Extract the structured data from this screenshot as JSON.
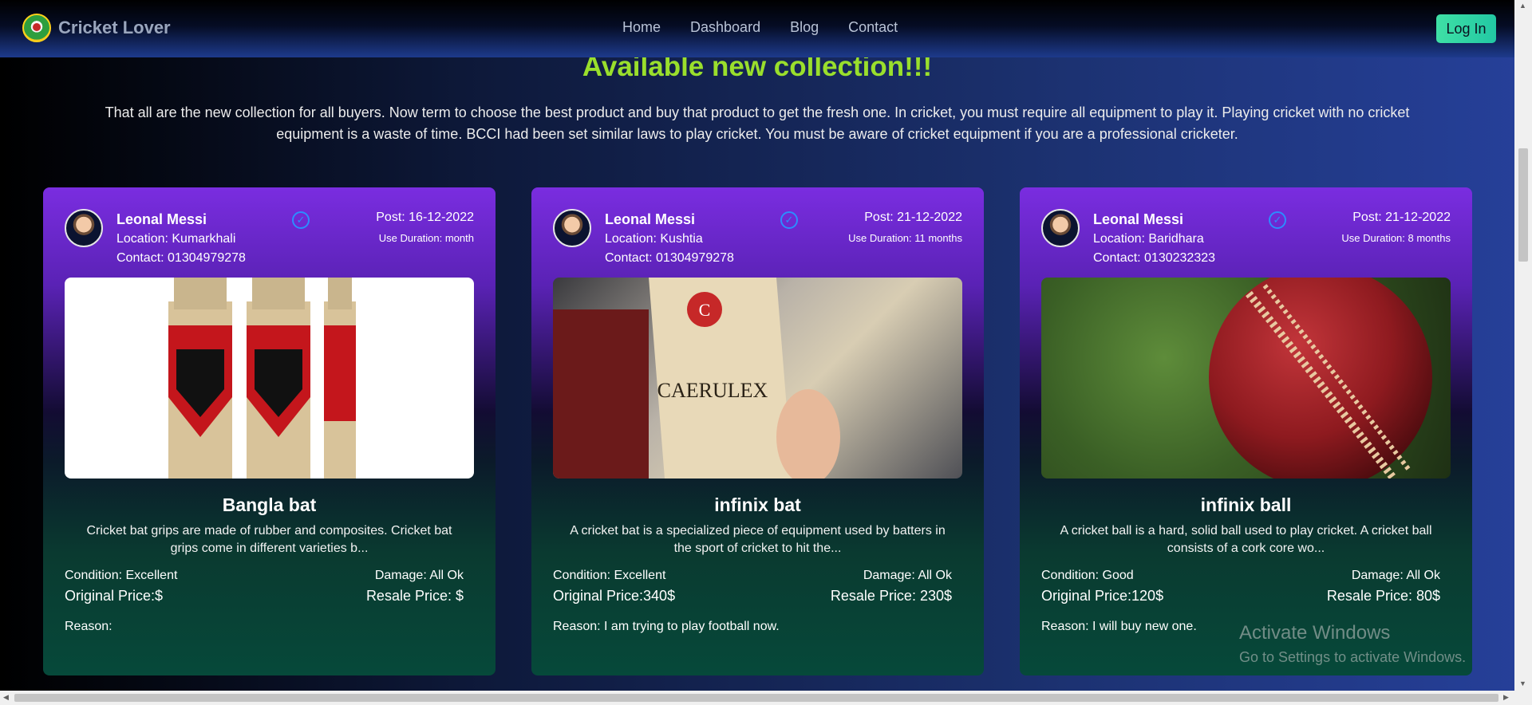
{
  "navbar": {
    "brand": "Cricket Lover",
    "links": [
      "Home",
      "Dashboard",
      "Blog",
      "Contact"
    ],
    "login_label": "Log In"
  },
  "main": {
    "heading": "Available new collection!!!",
    "intro": "That all are the new collection for all buyers. Now term to choose the best product and buy that product to get the fresh one. In cricket, you must require all equipment to play it. Playing cricket with no cricket equipment is a waste of time. BCCI had been set similar laws to play cricket. You must be aware of cricket equipment if you are a professional cricketer."
  },
  "cards": [
    {
      "seller": "Leonal Messi",
      "location": "Location: Kumarkhali",
      "contact": "Contact: 01304979278",
      "post": "Post: 16-12-2022",
      "duration": "Use Duration: month",
      "title": "Bangla bat",
      "description": "Cricket bat grips are made of rubber and composites. Cricket bat grips come in different varieties b...",
      "condition": "Condition: Excellent",
      "damage": "Damage: All Ok",
      "original_price": "Original Price:$",
      "resale_price": "Resale Price: $",
      "reason": "Reason:"
    },
    {
      "seller": "Leonal Messi",
      "location": "Location: Kushtia",
      "contact": "Contact: 01304979278",
      "post": "Post: 21-12-2022",
      "duration": "Use Duration: 11 months",
      "title": "infinix bat",
      "description": "A cricket bat is a specialized piece of equipment used by batters in the sport of cricket to hit the...",
      "condition": "Condition: Excellent",
      "damage": "Damage: All Ok",
      "original_price": "Original Price:340$",
      "resale_price": "Resale Price: 230$",
      "reason": "Reason: I am trying to play football now."
    },
    {
      "seller": "Leonal Messi",
      "location": "Location: Baridhara",
      "contact": "Contact: 0130232323",
      "post": "Post: 21-12-2022",
      "duration": "Use Duration: 8 months",
      "title": "infinix ball",
      "description": "A cricket ball is a hard, solid ball used to play cricket. A cricket ball consists of a cork core wo...",
      "condition": "Condition: Good",
      "damage": "Damage: All Ok",
      "original_price": "Original Price:120$",
      "resale_price": "Resale Price: 80$",
      "reason": "Reason: I will buy new one."
    }
  ],
  "watermark": {
    "title": "Activate Windows",
    "subtitle": "Go to Settings to activate Windows."
  },
  "icons": {
    "verified": "check-circle-icon",
    "logo": "cricket-logo-icon"
  },
  "colors": {
    "heading": "#9adf2c",
    "login": "#3fe0a5",
    "verified": "#2c8cff"
  }
}
